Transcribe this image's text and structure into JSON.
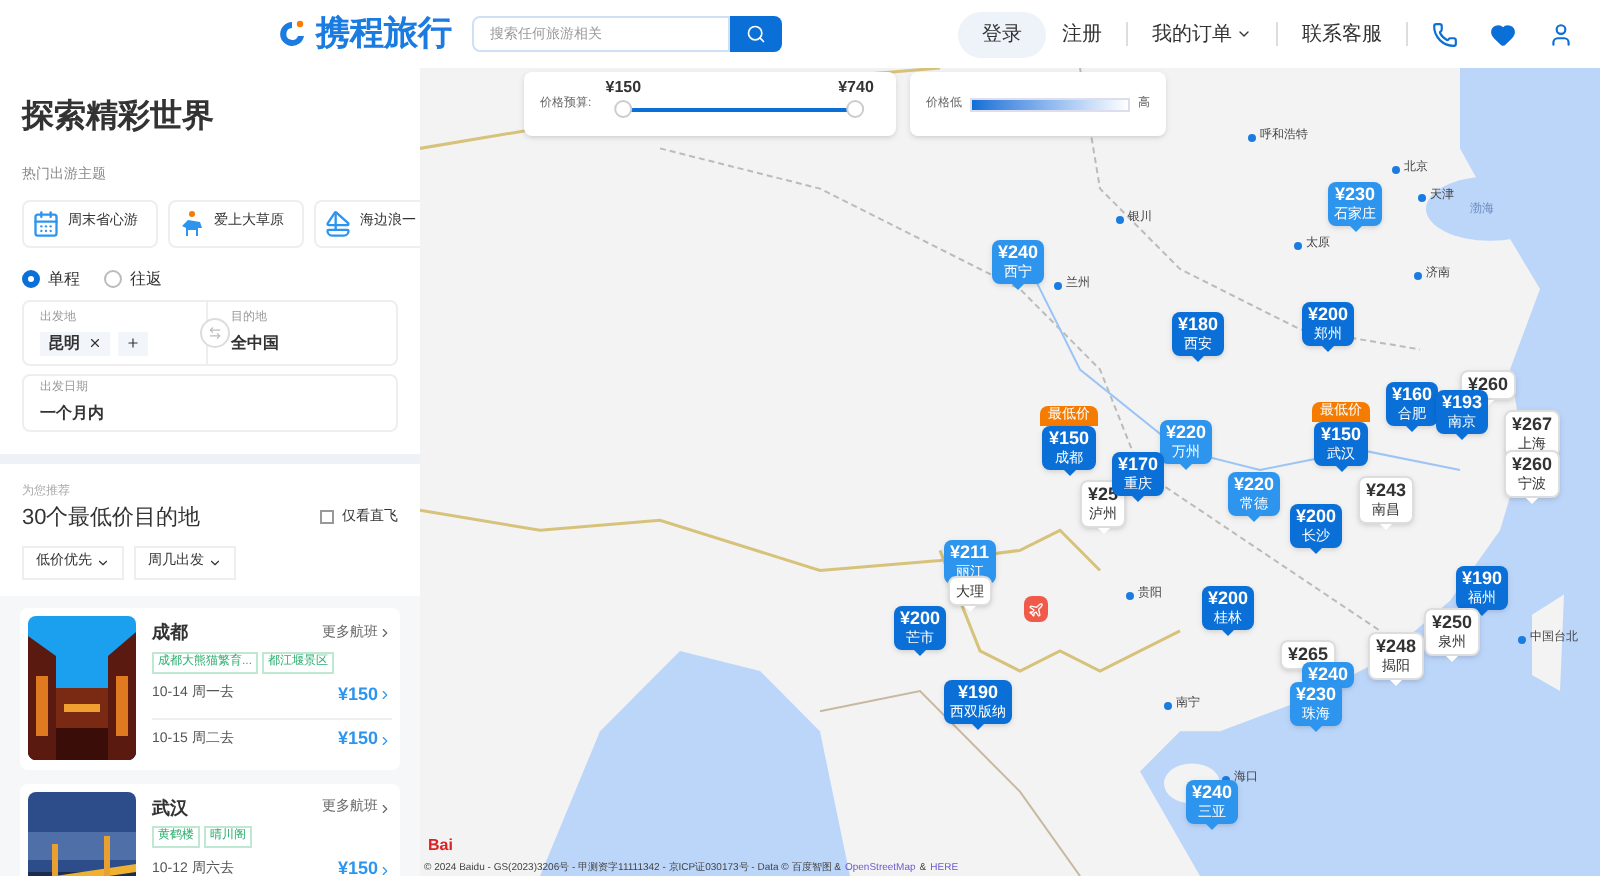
{
  "header": {
    "logo": "携程旅行",
    "search": {
      "placeholder": "搜索任何旅游相关"
    },
    "nav": [
      {
        "kind": "pill",
        "label": "登录"
      },
      {
        "kind": "text",
        "label": "注册"
      },
      {
        "kind": "divider"
      },
      {
        "kind": "menu",
        "label": "我的订单"
      },
      {
        "kind": "divider"
      },
      {
        "kind": "text",
        "label": "联系客服"
      },
      {
        "kind": "divider"
      },
      {
        "kind": "phone"
      },
      {
        "kind": "heart"
      },
      {
        "kind": "user"
      }
    ]
  },
  "sidebar": {
    "title": "探索精彩世界",
    "themes_label": "热门出游主题",
    "themes": [
      {
        "kind": "calendar",
        "label": "周末省心游"
      },
      {
        "kind": "horse",
        "label": "爱上大草原"
      },
      {
        "kind": "sail",
        "label": "海边浪一"
      }
    ],
    "trip_types": [
      {
        "label": "单程",
        "selected": true
      },
      {
        "label": "往返",
        "selected": false
      }
    ],
    "from": {
      "label": "出发地",
      "chips": [
        "昆明"
      ]
    },
    "to": {
      "label": "目的地",
      "value": "全中国"
    },
    "date": {
      "label": "出发日期",
      "value": "一个月内"
    },
    "recommend_label": "为您推荐",
    "recommend_title": "30个最低价目的地",
    "direct_only": {
      "label": "仅看直飞",
      "checked": false
    },
    "filters": [
      "低价优先",
      "周几出发"
    ],
    "cards": [
      {
        "city": "成都",
        "more": "更多航班",
        "tags": [
          "成都大熊猫繁育...",
          "都江堰景区"
        ],
        "flights": [
          {
            "date": "10-14 周一去",
            "price": "¥150"
          },
          {
            "date": "10-15 周二去",
            "price": "¥150"
          }
        ]
      },
      {
        "city": "武汉",
        "more": "更多航班",
        "tags": [
          "黄鹤楼",
          "晴川阁"
        ],
        "flights": [
          {
            "date": "10-12 周六去",
            "price": "¥150"
          }
        ]
      }
    ]
  },
  "map": {
    "budget": {
      "label": "价格预算:",
      "thumbs": [
        {
          "label": "¥150",
          "level": 0
        },
        {
          "label": "¥740",
          "level": 1
        }
      ]
    },
    "legend": {
      "low": "价格低",
      "high": "高"
    },
    "cities": [
      "呼和浩特",
      "北京",
      "天津",
      "银川",
      "太原",
      "济南",
      "兰州",
      "贵阳",
      "南宁",
      "海口",
      "中国台北"
    ],
    "sea_labels": [
      "渤海"
    ],
    "pins": [
      {
        "price": "¥230",
        "city": "石家庄",
        "kind": "mid"
      },
      {
        "price": "¥240",
        "city": "西宁",
        "kind": "mid"
      },
      {
        "price": "¥180",
        "city": "西安",
        "kind": "dark"
      },
      {
        "price": "¥200",
        "city": "郑州",
        "kind": "dark"
      },
      {
        "price": "¥260",
        "kind": "white"
      },
      {
        "price": "¥160",
        "city": "合肥",
        "kind": "dark"
      },
      {
        "price": "¥193",
        "city": "南京",
        "kind": "dark"
      },
      {
        "price": "¥267",
        "city": "上海",
        "kind": "white"
      },
      {
        "price": "¥260",
        "city": "宁波",
        "kind": "white"
      },
      {
        "price": "¥150",
        "city": "成都",
        "kind": "dark",
        "badge": "最低价"
      },
      {
        "price": "¥150",
        "city": "武汉",
        "kind": "dark",
        "badge": "最低价"
      },
      {
        "price": "¥25",
        "city": "泸州",
        "kind": "white"
      },
      {
        "price": "¥220",
        "city": "万州",
        "kind": "mid"
      },
      {
        "price": "¥170",
        "city": "重庆",
        "kind": "dark"
      },
      {
        "price": "¥220",
        "city": "常德",
        "kind": "mid"
      },
      {
        "price": "¥200",
        "city": "长沙",
        "kind": "dark"
      },
      {
        "price": "¥243",
        "city": "南昌",
        "kind": "white"
      },
      {
        "price": "¥211",
        "city": "丽江",
        "kind": "mid"
      },
      {
        "city": "大理",
        "kind": "white"
      },
      {
        "price": "¥200",
        "city": "芒市",
        "kind": "dark"
      },
      {
        "price": "¥200",
        "city": "桂林",
        "kind": "dark"
      },
      {
        "price": "¥190",
        "city": "西双版纳",
        "kind": "dark"
      },
      {
        "price": "¥190",
        "city": "福州",
        "kind": "dark"
      },
      {
        "price": "¥250",
        "city": "泉州",
        "kind": "white"
      },
      {
        "price": "¥265",
        "kind": "white"
      },
      {
        "price": "¥248",
        "city": "揭阳",
        "kind": "white"
      },
      {
        "price": "¥240",
        "kind": "mid"
      },
      {
        "price": "¥230",
        "city": "珠海",
        "kind": "mid"
      },
      {
        "price": "¥240",
        "city": "三亚",
        "kind": "mid"
      }
    ],
    "map_logo": "Bai",
    "attribution": [
      "© 2024 Baidu - GS(2023)3206号 - 甲测资字11111342 - 京ICP证030173号 - Data © 百度智图 &",
      "OpenStreetMap",
      "&",
      "HERE"
    ]
  }
}
